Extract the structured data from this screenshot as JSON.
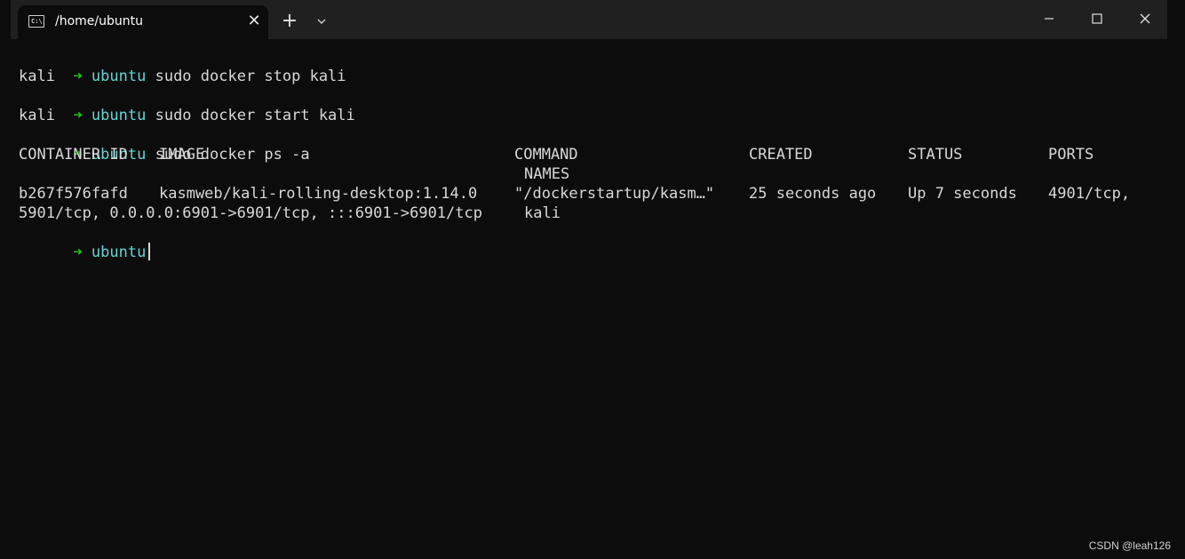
{
  "window": {
    "tab_title": "/home/ubuntu",
    "tab_icon_text": "C:\\",
    "close_tab": "✕",
    "new_tab": "+"
  },
  "prompt": {
    "arrow": "➜",
    "dir": "ubuntu"
  },
  "history": [
    {
      "command": "sudo docker stop kali",
      "output": "kali"
    },
    {
      "command": "sudo docker start kali",
      "output": "kali"
    },
    {
      "command": "sudo docker ps -a"
    }
  ],
  "ps_table": {
    "headers": {
      "container_id": "CONTAINER ID",
      "image": "IMAGE",
      "command": "COMMAND",
      "created": "CREATED",
      "status": "STATUS",
      "ports": "PORTS",
      "names": "NAMES"
    },
    "row": {
      "container_id": "b267f576fafd",
      "image": "kasmweb/kali-rolling-desktop:1.14.0",
      "command": "\"/dockerstartup/kasm…\"",
      "created": "25 seconds ago",
      "status": "Up 7 seconds",
      "ports_1": "4901/tcp,",
      "ports_2": "5901/tcp, 0.0.0.0:6901->6901/tcp, :::6901->6901/tcp",
      "names": "kali"
    }
  },
  "watermark": "CSDN @leah126",
  "colors": {
    "background": "#0c0c0c",
    "titlebar": "#202020",
    "prompt_arrow": "#16c60c",
    "prompt_dir": "#61d6d6",
    "text": "#d8d8d8"
  }
}
